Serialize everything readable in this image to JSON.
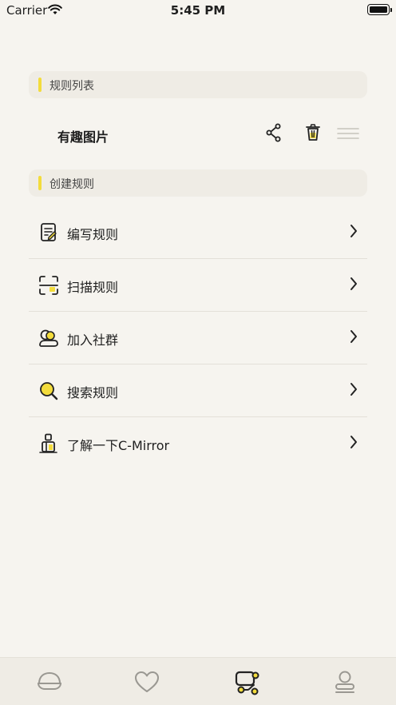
{
  "status_bar": {
    "carrier": "Carrier",
    "time": "5:45 PM"
  },
  "rule_list": {
    "header": "规则列表",
    "items": [
      {
        "name": "有趣图片"
      }
    ]
  },
  "create_rules": {
    "header": "创建规则",
    "items": [
      {
        "label": "编写规则",
        "icon": "edit-doc-icon"
      },
      {
        "label": "扫描规则",
        "icon": "scan-icon"
      },
      {
        "label": "加入社群",
        "icon": "community-icon"
      },
      {
        "label": "搜索规则",
        "icon": "search-icon"
      },
      {
        "label": "了解一下C-Mirror",
        "icon": "info-person-icon"
      }
    ]
  },
  "tab_bar": {
    "tabs": [
      {
        "icon": "home-icon",
        "active": false
      },
      {
        "icon": "heart-icon",
        "active": false
      },
      {
        "icon": "rules-icon",
        "active": true
      },
      {
        "icon": "profile-icon",
        "active": false
      }
    ]
  },
  "colors": {
    "accent": "#f3dc3c",
    "background": "#f6f4ef",
    "header_bg": "#efece5"
  }
}
